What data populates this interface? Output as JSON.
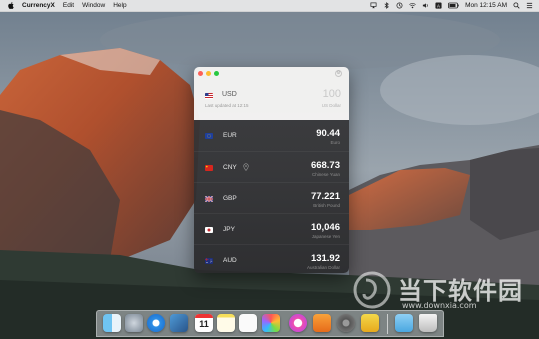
{
  "menubar": {
    "app_name": "CurrencyX",
    "items": [
      "Edit",
      "Window",
      "Help"
    ],
    "status": {
      "day_time": "Mon 12:15 AM"
    }
  },
  "window": {
    "base": {
      "code": "USD",
      "amount": "100",
      "updated": "Last updated at 12:15",
      "name": "US Dollar",
      "flag": "us-flag"
    },
    "rows": [
      {
        "code": "EUR",
        "amount": "90.44",
        "name": "Euro",
        "flag": "eu-flag"
      },
      {
        "code": "CNY",
        "amount": "668.73",
        "name": "Chinese Yuan",
        "flag": "cn-flag"
      },
      {
        "code": "GBP",
        "amount": "77.221",
        "name": "British Pound",
        "flag": "gb-flag"
      },
      {
        "code": "JPY",
        "amount": "10,046",
        "name": "Japanese Yen",
        "flag": "jp-flag"
      },
      {
        "code": "AUD",
        "amount": "131.92",
        "name": "Australian Dollar",
        "flag": "au-flag"
      }
    ]
  },
  "dock": {
    "icons": [
      "finder-icon",
      "launchpad-icon",
      "safari-icon",
      "preview-icon",
      "calendar-icon",
      "notes-icon",
      "reminders-icon",
      "photos-icon",
      "itunes-icon",
      "ibooks-icon",
      "system-preferences-icon",
      "currencyx-icon",
      "downloads-folder-icon",
      "trash-icon"
    ]
  },
  "watermark": {
    "text": "当下软件园",
    "url": "www.downxia.com"
  },
  "colors": {
    "close": "#fc5f57",
    "minimize": "#fdbc2e",
    "maximize": "#28c840",
    "list_bg": "#343436"
  }
}
